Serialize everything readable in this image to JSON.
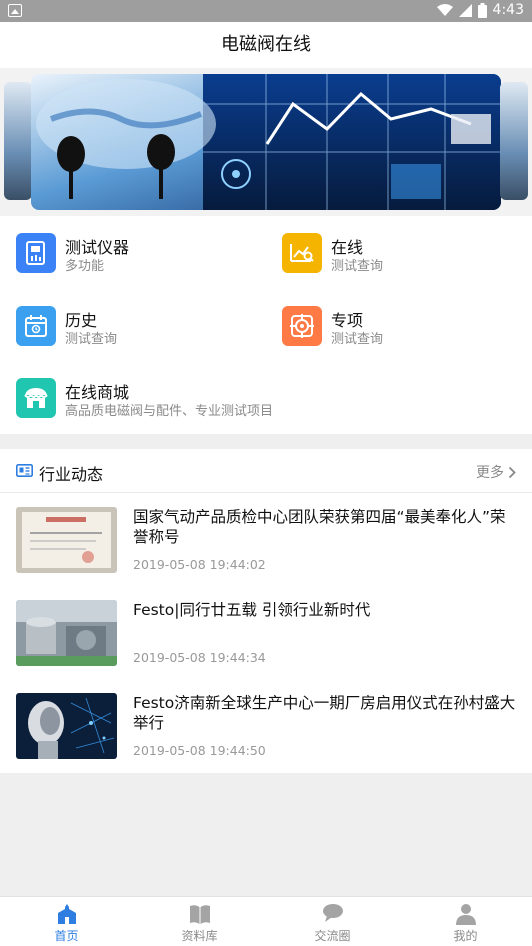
{
  "status_bar": {
    "time": "4:43"
  },
  "header": {
    "title": "电磁阀在线"
  },
  "functions": [
    {
      "title": "测试仪器",
      "subtitle": "多功能",
      "icon": "instrument-icon",
      "color": "#3b82f6"
    },
    {
      "title": "在线",
      "subtitle": "测试查询",
      "icon": "chart-search-icon",
      "color": "#f5b400"
    },
    {
      "title": "历史",
      "subtitle": "测试查询",
      "icon": "calendar-icon",
      "color": "#3aa0ef"
    },
    {
      "title": "专项",
      "subtitle": "测试查询",
      "icon": "target-icon",
      "color": "#ff7a45"
    },
    {
      "title": "在线商城",
      "subtitle": "高品质电磁阀与配件、专业测试项目",
      "icon": "store-icon",
      "color": "#21c6b0"
    }
  ],
  "news": {
    "section_title": "行业动态",
    "more_label": "更多",
    "articles": [
      {
        "title": "国家气动产品质检中心团队荣获第四届“最美奉化人”荣誉称号",
        "time": "2019-05-08 19:44:02",
        "thumb": "certificate-photo"
      },
      {
        "title": "Festo|同行廿五载 引领行业新时代",
        "time": "2019-05-08 19:44:34",
        "thumb": "factory-photo"
      },
      {
        "title": "Festo济南新全球生产中心一期厂房启用仪式在孙村盛大举行",
        "time": "2019-05-08 19:44:50",
        "thumb": "robot-photo"
      }
    ]
  },
  "tabbar": {
    "active": 0,
    "items": [
      {
        "label": "首页",
        "icon": "home-icon"
      },
      {
        "label": "资料库",
        "icon": "book-icon"
      },
      {
        "label": "交流圈",
        "icon": "chat-icon"
      },
      {
        "label": "我的",
        "icon": "user-icon"
      }
    ]
  },
  "colors": {
    "accent": "#2e7de1",
    "muted": "#8a8a8a"
  }
}
